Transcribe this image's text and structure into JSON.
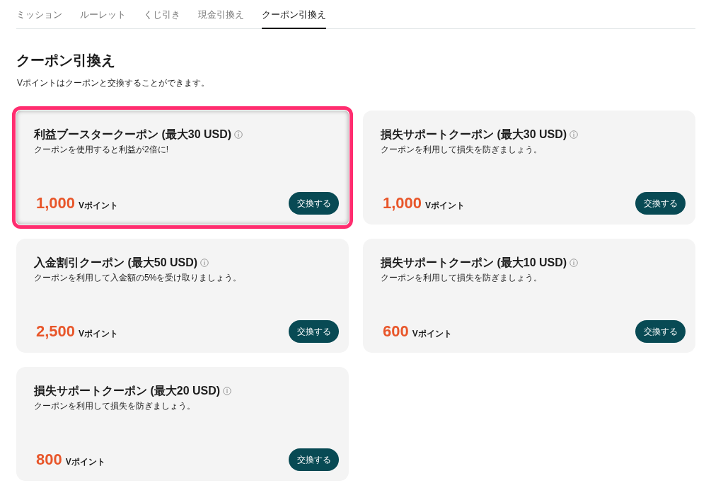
{
  "tabs": [
    {
      "label": "ミッション",
      "selected": false
    },
    {
      "label": "ルーレット",
      "selected": false
    },
    {
      "label": "くじ引き",
      "selected": false
    },
    {
      "label": "現金引換え",
      "selected": false
    },
    {
      "label": "クーポン引換え",
      "selected": true
    }
  ],
  "heading": "クーポン引換え",
  "subtitle": "Vポイントはクーポンと交換することができます。",
  "coupons": [
    {
      "title": "利益ブースタークーポン (最大30 USD)",
      "description": "クーポンを使用すると利益が2倍に!",
      "points": "1,000",
      "unit": "Vポイント",
      "button": "交換する",
      "highlighted": true
    },
    {
      "title": "損失サポートクーポン (最大30 USD)",
      "description": "クーポンを利用して損失を防ぎましょう。",
      "points": "1,000",
      "unit": "Vポイント",
      "button": "交換する",
      "highlighted": false
    },
    {
      "title": "入金割引クーポン (最大50 USD)",
      "description": "クーポンを利用して入金額の5%を受け取りましょう。",
      "points": "2,500",
      "unit": "Vポイント",
      "button": "交換する",
      "highlighted": false
    },
    {
      "title": "損失サポートクーポン (最大10 USD)",
      "description": "クーポンを利用して損失を防ぎましょう。",
      "points": "600",
      "unit": "Vポイント",
      "button": "交換する",
      "highlighted": false
    },
    {
      "title": "損失サポートクーポン (最大20 USD)",
      "description": "クーポンを利用して損失を防ぎましょう。",
      "points": "800",
      "unit": "Vポイント",
      "button": "交換する",
      "highlighted": false
    }
  ]
}
